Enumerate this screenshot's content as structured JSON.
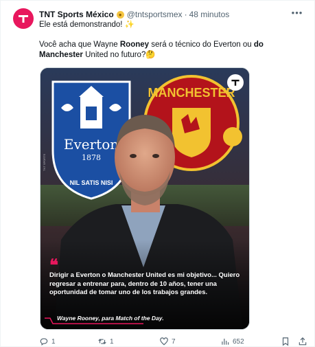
{
  "tweet": {
    "author": {
      "display_name": "TNT Sports México",
      "badge_icon": "soccer-ball-emoji",
      "handle": "@tntsportsmex",
      "separator": "·",
      "time": "48 minutos"
    },
    "line1": "Ele está demonstrando! ✨",
    "line2_parts": {
      "a": "Você acha que Wayne ",
      "b": "Rooney",
      "c": " será o técnico do Everton ou ",
      "d": "do Manchester",
      "e": " United no futuro?🤔"
    }
  },
  "media": {
    "crest_left": {
      "name": "Everton",
      "year": "1878",
      "motto": "NIL SATIS NISI"
    },
    "crest_right": {
      "name": "MANCHESTER"
    },
    "side_credit": "TNT SPORTS",
    "quote_mark": "❝",
    "quote": "Dirigir a Everton o Manchester United es mi objetivo... Quiero regresar a entrenar para, dentro de 10 años, tener una oportunidad de tomar uno de los trabajos grandes.",
    "attribution": "Wayne Rooney, para Match of the Day."
  },
  "actions": {
    "reply_count": "1",
    "retweet_count": "1",
    "like_count": "7",
    "view_count": "652"
  },
  "colors": {
    "brand": "#e8175d",
    "text": "#0f1419",
    "muted": "#536471"
  }
}
